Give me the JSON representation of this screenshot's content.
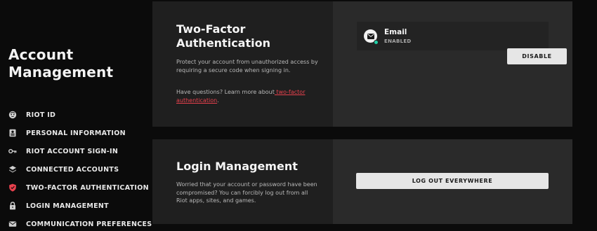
{
  "sidebar": {
    "title_line1": "Account",
    "title_line2": "Management",
    "items": [
      {
        "label": "RIOT ID",
        "icon": "face-icon"
      },
      {
        "label": "PERSONAL INFORMATION",
        "icon": "id-card-icon"
      },
      {
        "label": "RIOT ACCOUNT SIGN-IN",
        "icon": "key-icon"
      },
      {
        "label": "CONNECTED ACCOUNTS",
        "icon": "layers-icon"
      },
      {
        "label": "TWO-FACTOR AUTHENTICATION",
        "icon": "shield-icon",
        "active": true
      },
      {
        "label": "LOGIN MANAGEMENT",
        "icon": "lock-icon"
      },
      {
        "label": "COMMUNICATION PREFERENCES",
        "icon": "mail-icon"
      }
    ]
  },
  "two_factor": {
    "title_line1": "Two-Factor",
    "title_line2": "Authentication",
    "description": "Protect your account from unauthorized access by requiring a secure code when signing in.",
    "help_prefix": "Have questions? Learn more about",
    "help_link": " two-factor authentication",
    "help_suffix": ".",
    "method": {
      "name": "Email",
      "status": "ENABLED",
      "icon": "envelope-icon",
      "button_label": "DISABLE"
    }
  },
  "login_management": {
    "title": "Login Management",
    "description": "Worried that your account or password have been compromised? You can forcibly log out from all Riot apps, sites, and games.",
    "button_label": "LOG OUT EVERYWHERE"
  },
  "colors": {
    "background": "#0b0b0b",
    "card": "#1f1f1f",
    "card_right": "#2a2a2a",
    "accent_red": "#e8414d",
    "status_green": "#1fd0a7"
  }
}
